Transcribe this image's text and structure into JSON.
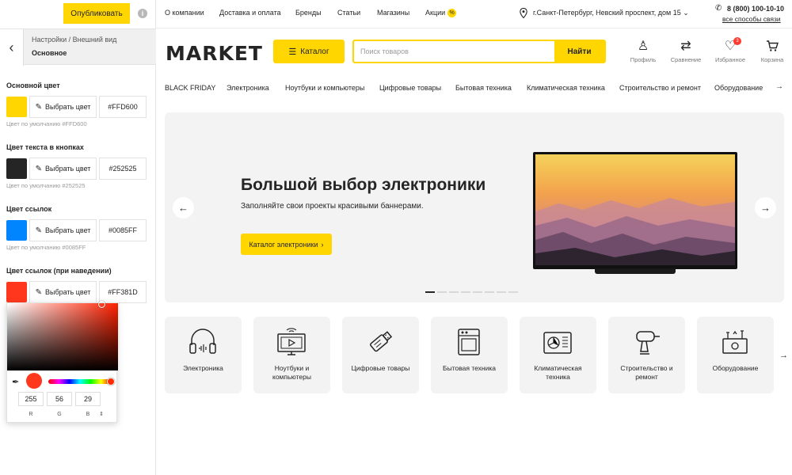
{
  "panel": {
    "publish_label": "Опубликовать",
    "info_icon": "i",
    "breadcrumb": "Настройки / Внешний вид",
    "section_title": "Основное",
    "pick_label": "Выбрать цвет",
    "colors": [
      {
        "label": "Основной цвет",
        "hex": "#FFD600",
        "swatch": "#FFD600",
        "default": "Цвет по умолчанию #FFD600"
      },
      {
        "label": "Цвет текста в кнопках",
        "hex": "#252525",
        "swatch": "#252525",
        "default": "Цвет по умолчанию #252525"
      },
      {
        "label": "Цвет ссылок",
        "hex": "#0085FF",
        "swatch": "#0085FF",
        "default": "Цвет по умолчанию #0085FF"
      },
      {
        "label": "Цвет ссылок (при наведении)",
        "hex": "#FF381D",
        "swatch": "#FF381D"
      }
    ],
    "picker": {
      "r": "255",
      "g": "56",
      "b": "29",
      "r_label": "R",
      "g_label": "G",
      "b_label": "B",
      "toggle": "⇕"
    }
  },
  "topbar": {
    "links": [
      "О компании",
      "Доставка и оплата",
      "Бренды",
      "Статьи",
      "Магазины",
      "Акции"
    ],
    "promo_badge": "%",
    "location": "г.Санкт-Петербург, Невский проспект, дом 15",
    "phone": "8 (800) 100-10-10",
    "all_contacts": "все способы связи"
  },
  "header": {
    "logo": "MARKET",
    "catalog_label": "Каталог",
    "search_placeholder": "Поиск товаров",
    "search_button": "Найти",
    "icons": [
      {
        "name": "profile-icon",
        "label": "Профиль",
        "glyph": "♙"
      },
      {
        "name": "compare-icon",
        "label": "Сравнение",
        "glyph": "⇄"
      },
      {
        "name": "favorites-icon",
        "label": "Избранное",
        "glyph": "♡",
        "badge": "3"
      },
      {
        "name": "cart-icon",
        "label": "Корзина",
        "glyph": "🛒"
      }
    ]
  },
  "catnav": [
    "BLACK FRIDAY",
    "Электроника",
    "Ноутбуки и компьютеры",
    "Цифровые товары",
    "Бытовая техника",
    "Климатическая техника",
    "Строительство и ремонт",
    "Оборудование"
  ],
  "banner": {
    "title": "Большой выбор электроники",
    "subtitle": "Заполняйте свои проекты красивыми баннерами.",
    "cta": "Каталог электроники",
    "slides": 8,
    "active_slide": 1
  },
  "categories": [
    "Электроника",
    "Ноутбуки и компьютеры",
    "Цифровые товары",
    "Бытовая техника",
    "Климатическая техника",
    "Строительство и ремонт",
    "Оборудование"
  ],
  "colors": {
    "accent": "#FFD600",
    "text": "#252525",
    "link": "#0085FF",
    "link_hover": "#FF381D"
  }
}
